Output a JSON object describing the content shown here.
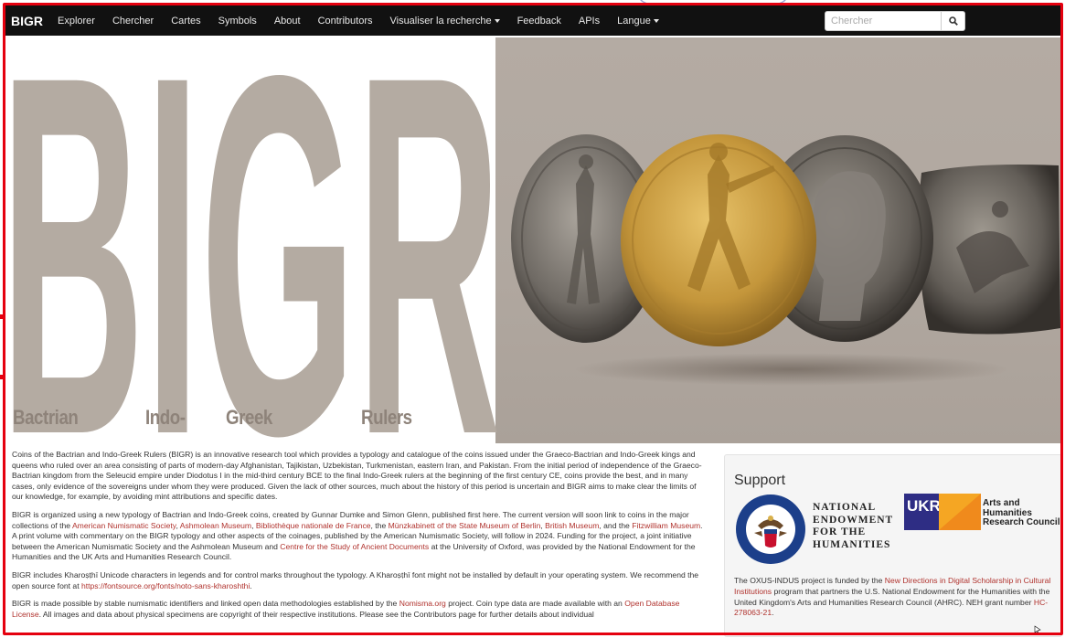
{
  "navbar": {
    "brand": "BIGR",
    "items": [
      {
        "label": "Explorer"
      },
      {
        "label": "Chercher"
      },
      {
        "label": "Cartes"
      },
      {
        "label": "Symbols"
      },
      {
        "label": "About"
      },
      {
        "label": "Contributors"
      },
      {
        "label": "Visualiser la recherche",
        "dropdown": true
      },
      {
        "label": "Feedback"
      },
      {
        "label": "APIs"
      },
      {
        "label": "Langue",
        "dropdown": true
      }
    ],
    "search_placeholder": "Chercher"
  },
  "banner": {
    "big_text": "BIGR",
    "captions": [
      "Bactrian",
      "Indo-",
      "Greek",
      "Rulers"
    ]
  },
  "content": {
    "p1": "Coins of the Bactrian and Indo-Greek Rulers (BIGR) is an innovative research tool which provides a typology and catalogue of the coins issued under the Graeco-Bactrian and Indo-Greek kings and queens who ruled over an area consisting of parts of modern-day Afghanistan, Tajikistan, Uzbekistan, Turkmenistan, eastern Iran, and Pakistan. From the initial period of independence of the Graeco-Bactrian kingdom from the Seleucid empire under Diodotus I in the mid-third century BCE to the final Indo-Greek rulers at the beginning of the first century CE, coins provide the best, and in many cases, only evidence of the sovereigns under whom they were produced. Given the lack of other sources, much about the history of this period is uncertain and BIGR aims to make clear the limits of our knowledge, for example, by avoiding mint attributions and specific dates.",
    "p2": {
      "t1": "BIGR is organized using a new typology of Bactrian and Indo-Greek coins, created by Gunnar Dumke and Simon Glenn, published first here. The current version will soon link to coins in the major collections of the ",
      "l1": "American Numismatic Society",
      "t2": ", ",
      "l2": "Ashmolean Museum",
      "t3": ", ",
      "l3": "Bibliothèque nationale de France",
      "t4": ", the ",
      "l4": "Münzkabinett of the State Museum of Berlin",
      "t5": ", ",
      "l5": "British Museum",
      "t6": ", and the ",
      "l6": "Fitzwilliam Museum",
      "t7": ". A print volume with commentary on the BIGR typology and other aspects of the coinages, published by the American Numismatic Society, will follow in 2024. Funding for the project, a joint initiative between the American Numismatic Society and the Ashmolean Museum and ",
      "l7": "Centre for the Study of Ancient Documents",
      "t8": " at the University of Oxford, was provided by the National Endowment for the Humanities and the UK Arts and Humanities Research Council."
    },
    "p3": {
      "t1": "BIGR includes Kharoṣṭhī Unicode characters in legends and for control marks throughout the typology. A Kharoṣṭhī font might not be installed by default in your operating system. We recommend the open source font at ",
      "l1": "https://fontsource.org/fonts/noto-sans-kharoshthi",
      "t2": "."
    },
    "p4": {
      "t1": "BIGR is made possible by stable numismatic identifiers and linked open data methodologies established by the ",
      "l1": "Nomisma.org",
      "t2": " project. Coin type data are made available with an ",
      "l2": "Open Database License",
      "t3": ". All images and data about physical specimens are copyright of their respective institutions. Please see the Contributors page for further details about individual"
    }
  },
  "support": {
    "title": "Support",
    "neh_lines": [
      "NATIONAL",
      "ENDOWMENT",
      "FOR THE",
      "HUMANITIES"
    ],
    "ukri_label": "UKRI",
    "ahrc_lines": [
      "Arts and",
      "Humanities",
      "Research Council"
    ],
    "desc": {
      "t1": "The OXUS-INDUS project is funded by the ",
      "l1": "New Directions in Digital Scholarship in Cultural Institutions",
      "t2": " program that partners the U.S. National Endowment for the Humanities with the United Kingdom's Arts and Humanities Research Council (AHRC). NEH grant number ",
      "l2": "HC-278063-21",
      "t3": "."
    }
  },
  "colors": {
    "navbar_bg": "#111111",
    "link": "#b0322d",
    "frame": "#e5000f",
    "banner_bg": "#b0a79f",
    "gold_coin": "#c99a3a",
    "silver_coin": "#8a8580"
  }
}
